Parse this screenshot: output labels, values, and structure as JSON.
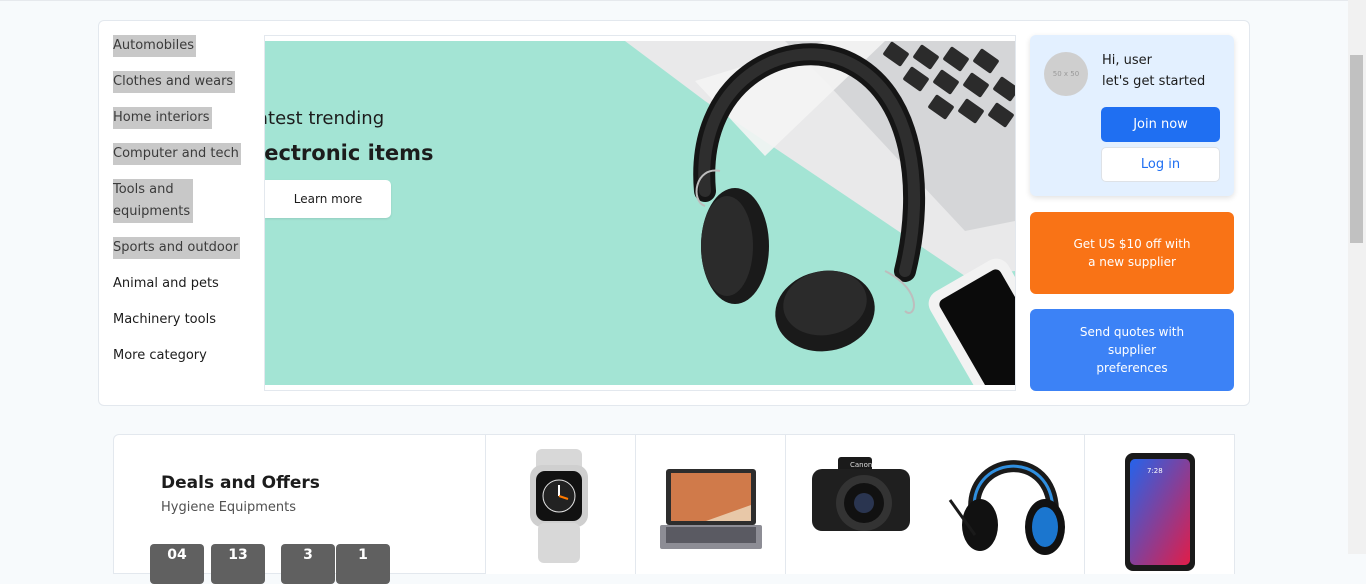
{
  "sidebar": {
    "categories": [
      {
        "label": "Automobiles",
        "highlighted": true
      },
      {
        "label": "Clothes and wears",
        "highlighted": true
      },
      {
        "label": "Home interiors",
        "highlighted": true
      },
      {
        "label": "Computer and tech",
        "highlighted": true
      },
      {
        "label": "Tools and equipments",
        "highlighted": true
      },
      {
        "label": "Sports and outdoor",
        "highlighted": true
      },
      {
        "label": "Animal and pets",
        "highlighted": false
      },
      {
        "label": "Machinery tools",
        "highlighted": false
      },
      {
        "label": "More category",
        "highlighted": false
      }
    ]
  },
  "banner": {
    "line1": "atest trending",
    "line2": "lectronic items",
    "button": "Learn more",
    "background_color": "#a3e4d4"
  },
  "user_panel": {
    "avatar_text": "50 x 50",
    "greeting_line1": "Hi, user",
    "greeting_line2": "let's get started",
    "join_button": "Join now",
    "login_button": "Log in"
  },
  "promos": {
    "orange": "Get US $10 off with a new supplier",
    "blue": "Send quotes with supplier preferences",
    "orange_color": "#f97316",
    "blue_color": "#3c82f6"
  },
  "deals": {
    "title": "Deals and Offers",
    "subtitle": "Hygiene Equipments",
    "timer": [
      "04",
      "13",
      "3",
      "1"
    ]
  },
  "products": [
    {
      "icon": "smartwatch-image"
    },
    {
      "icon": "laptop-image"
    },
    {
      "icon": "camera-image"
    },
    {
      "icon": "gaming-headset-image"
    },
    {
      "icon": "smartphone-image"
    }
  ],
  "colors": {
    "accent": "#1f6ff2"
  }
}
